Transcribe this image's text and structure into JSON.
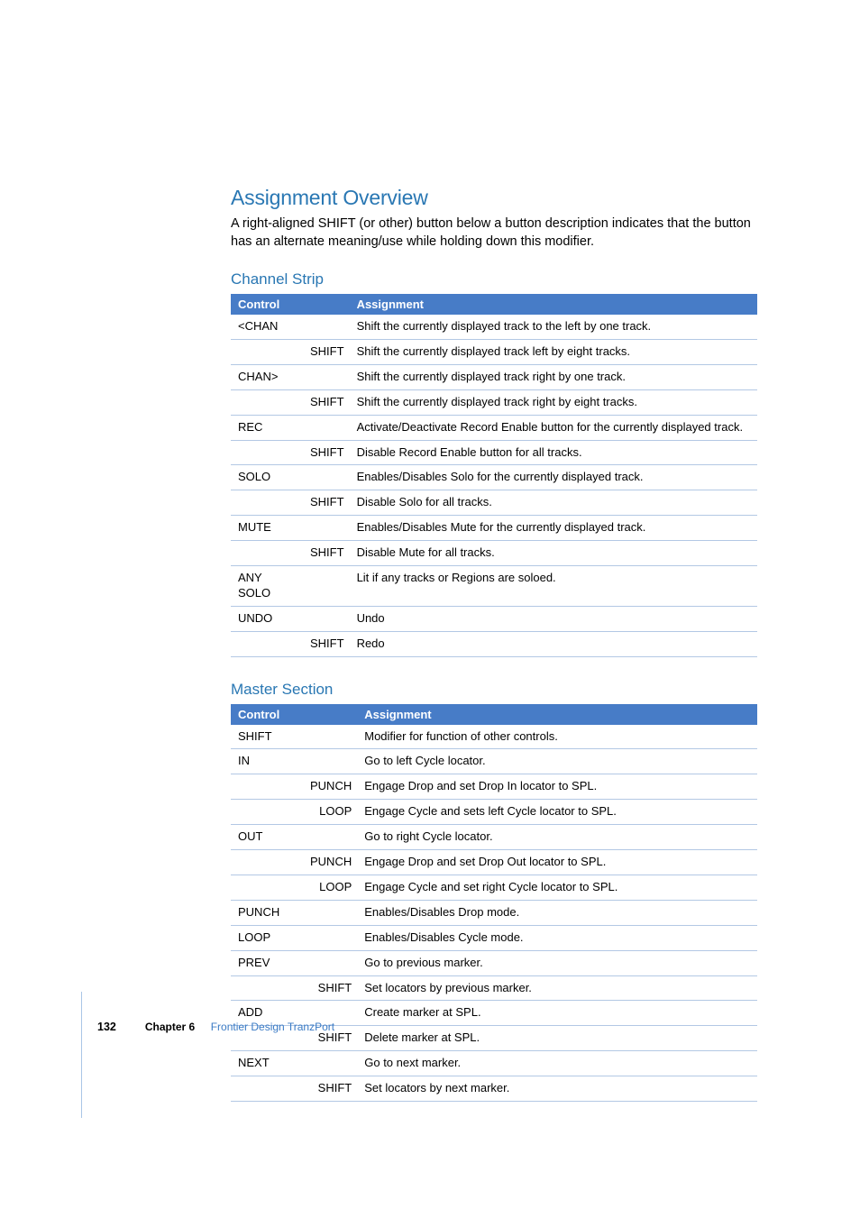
{
  "heading": "Assignment Overview",
  "intro": "A right-aligned SHIFT (or other) button below a button description indicates that the button has an alternate meaning/use while holding down this modifier.",
  "section1": {
    "title": "Channel Strip",
    "header_control": "Control",
    "header_assignment": "Assignment",
    "rows": [
      {
        "control": "<CHAN",
        "mod": "",
        "assignment": "Shift the currently displayed track to the left by one track."
      },
      {
        "control": "",
        "mod": "SHIFT",
        "assignment": "Shift the currently displayed track left by eight tracks."
      },
      {
        "control": "CHAN>",
        "mod": "",
        "assignment": "Shift the currently displayed track right by one track."
      },
      {
        "control": "",
        "mod": "SHIFT",
        "assignment": "Shift the currently displayed track right by eight tracks."
      },
      {
        "control": "REC",
        "mod": "",
        "assignment": "Activate/Deactivate Record Enable button for the currently displayed track."
      },
      {
        "control": "",
        "mod": "SHIFT",
        "assignment": "Disable Record Enable button for all tracks."
      },
      {
        "control": "SOLO",
        "mod": "",
        "assignment": "Enables/Disables Solo for the currently displayed track."
      },
      {
        "control": "",
        "mod": "SHIFT",
        "assignment": "Disable Solo for all tracks."
      },
      {
        "control": "MUTE",
        "mod": "",
        "assignment": "Enables/Disables Mute for the currently displayed track."
      },
      {
        "control": "",
        "mod": "SHIFT",
        "assignment": "Disable Mute for all tracks."
      },
      {
        "control": "ANY SOLO",
        "mod": "",
        "assignment": "Lit if any tracks or Regions are soloed."
      },
      {
        "control": "UNDO",
        "mod": "",
        "assignment": "Undo"
      },
      {
        "control": "",
        "mod": "SHIFT",
        "assignment": "Redo"
      }
    ]
  },
  "section2": {
    "title": "Master Section",
    "header_control": "Control",
    "header_assignment": "Assignment",
    "rows": [
      {
        "control": "SHIFT",
        "mod": "",
        "assignment": "Modifier for function of other controls."
      },
      {
        "control": "IN",
        "mod": "",
        "assignment": "Go to left Cycle locator."
      },
      {
        "control": "",
        "mod": "PUNCH",
        "assignment": "Engage Drop and set Drop In locator to SPL."
      },
      {
        "control": "",
        "mod": "LOOP",
        "assignment": "Engage Cycle and sets left Cycle locator to SPL."
      },
      {
        "control": "OUT",
        "mod": "",
        "assignment": "Go to right Cycle locator."
      },
      {
        "control": "",
        "mod": "PUNCH",
        "assignment": "Engage Drop and set Drop Out locator to SPL."
      },
      {
        "control": "",
        "mod": "LOOP",
        "assignment": "Engage Cycle and set right Cycle locator to SPL."
      },
      {
        "control": "PUNCH",
        "mod": "",
        "assignment": "Enables/Disables Drop mode."
      },
      {
        "control": "LOOP",
        "mod": "",
        "assignment": "Enables/Disables Cycle mode."
      },
      {
        "control": "PREV",
        "mod": "",
        "assignment": "Go to previous marker."
      },
      {
        "control": "",
        "mod": "SHIFT",
        "assignment": "Set locators by previous marker."
      },
      {
        "control": "ADD",
        "mod": "",
        "assignment": "Create marker at SPL."
      },
      {
        "control": "",
        "mod": "SHIFT",
        "assignment": "Delete marker at SPL."
      },
      {
        "control": "NEXT",
        "mod": "",
        "assignment": "Go to next marker."
      },
      {
        "control": "",
        "mod": "SHIFT",
        "assignment": "Set locators by next marker."
      }
    ]
  },
  "footer": {
    "page": "132",
    "chapter": "Chapter 6",
    "title": "Frontier Design TranzPort"
  }
}
